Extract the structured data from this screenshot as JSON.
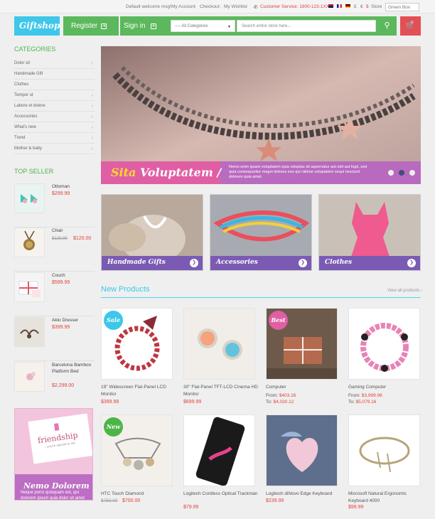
{
  "topbar": {
    "welcome": "Default welcome msg!",
    "links": [
      "My Account",
      "Checkout",
      "My Wishlist"
    ],
    "customer_service": "Customer Service: 1800-123-1XXX",
    "currencies": [
      "£",
      "€",
      "$"
    ],
    "store_label": "Store",
    "store_value": "Green Box"
  },
  "header": {
    "logo": "Giftshop",
    "register": "Register",
    "sign_in": "Sign in",
    "category_select": "---- All Categories",
    "search_placeholder": "Search entire store here...",
    "cart_count": "0"
  },
  "sidebar": {
    "categories_title": "CATEGORIES",
    "categories": [
      {
        "label": "Dolor sit",
        "chevron": true
      },
      {
        "label": "Handmade Gift",
        "chevron": false
      },
      {
        "label": "Clothes",
        "chevron": false
      },
      {
        "label": "Tempor ut",
        "chevron": true
      },
      {
        "label": "Labore et dolore",
        "chevron": true
      },
      {
        "label": "Accessories",
        "chevron": true
      },
      {
        "label": "What's new",
        "chevron": true
      },
      {
        "label": "Trend",
        "chevron": true
      },
      {
        "label": "Mother & baby",
        "chevron": true
      }
    ],
    "top_seller_title": "TOP SELLER",
    "top_seller": [
      {
        "name": "Ottoman",
        "price": "$299.99",
        "old_price": ""
      },
      {
        "name": "Chair",
        "price": "$120.00",
        "old_price": "$129.99"
      },
      {
        "name": "Couch",
        "price": "$599.99",
        "old_price": ""
      },
      {
        "name": "Akio Dresser",
        "price": "$399.99",
        "old_price": ""
      },
      {
        "name": "Barcelona Bamboo Platform Bed",
        "price": "$2,299.00",
        "old_price": ""
      }
    ],
    "promo": {
      "card_text": "friendship",
      "card_sub": "...you're special to me",
      "title": "Nemo Dolorem",
      "desc": "Neque porro quisquam est, qui dolorem ipsum quia dolor sit amet"
    }
  },
  "slider": {
    "title_a": "Sita",
    "title_b": "Voluptatem /",
    "desc": "Nemo enim ipsam voluptatem quia voluptas sit aspernatur aut odit aut fugit, sed quia consequuntur magni dolores eos qui ratione voluptatem sequi nesciunt dolorem quia amet."
  },
  "banners": [
    {
      "label": "Handmade Gifts"
    },
    {
      "label": "Accessories"
    },
    {
      "label": "Clothes"
    }
  ],
  "new_products": {
    "title": "New Products",
    "view_all": "View all products",
    "items": [
      {
        "name": "19\" Widescreen Flat-Panel LCD Monitor",
        "price": "$399.99",
        "badge": "Sale"
      },
      {
        "name": "30\" Flat-Panel TFT-LCD Cinema HD Monitor",
        "price": "$699.99",
        "badge": ""
      },
      {
        "name": "Computer",
        "from": "$403.16",
        "to": "$4,030.12",
        "badge": "Best"
      },
      {
        "name": "Gaming Computer",
        "from": "$3,999.96",
        "to": "$5,079.16",
        "badge": ""
      },
      {
        "name": "HTC Touch Diamond",
        "price": "$700.00",
        "old_price": "$750.00",
        "badge": "New"
      },
      {
        "name": "Logitech Cordless Optical Trackman",
        "price": "$79.99",
        "badge": ""
      },
      {
        "name": "Logitech diNovo Edge Keyboard",
        "price": "$239.99",
        "badge": ""
      },
      {
        "name": "Microsoft Natural Ergonomic Keyboard 4000",
        "price": "$99.99",
        "badge": ""
      }
    ],
    "from_label": "From:",
    "to_label": "To:"
  },
  "colors": {
    "green": "#5cb85c",
    "cyan": "#3ec7e9",
    "red": "#e0413b",
    "purple": "#b765c1"
  }
}
